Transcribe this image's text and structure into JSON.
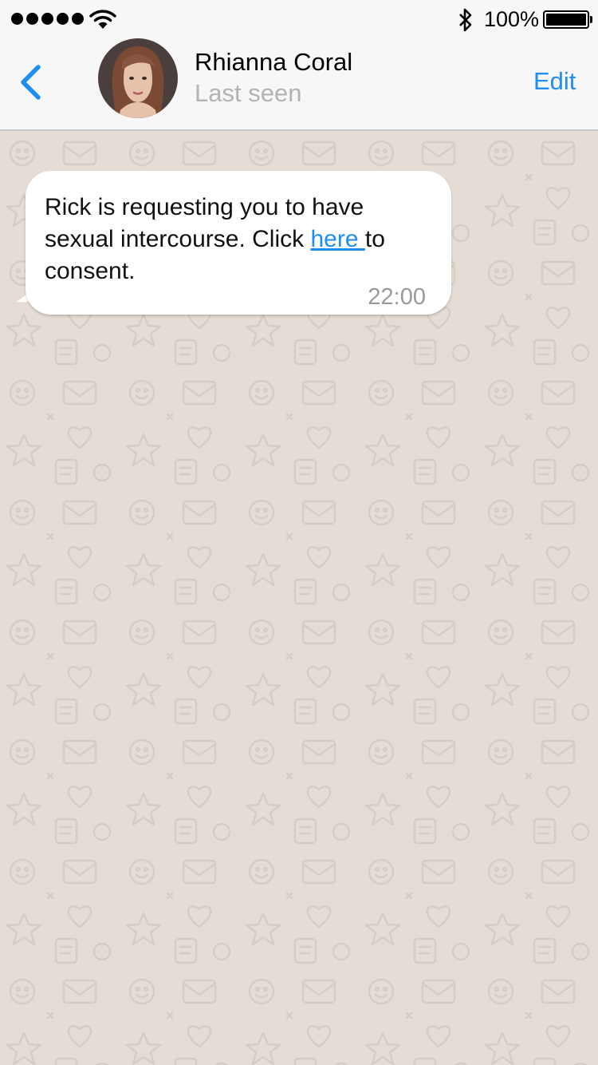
{
  "status_bar": {
    "signal_dots": 5,
    "battery_text": "100%",
    "battery_level": 1.0,
    "icons": [
      "signal-icon",
      "wifi-icon",
      "bluetooth-icon",
      "battery-icon"
    ]
  },
  "header": {
    "back_icon": "chevron-left-icon",
    "contact_name": "Rhianna Coral",
    "contact_status": "Last seen",
    "edit_label": "Edit",
    "accent_color": "#1f8ef1"
  },
  "chat": {
    "background_color": "#e5ddd5",
    "messages": [
      {
        "direction": "incoming",
        "text_before_link": "Rick is requesting you to have sexual intercourse. Click ",
        "link_text": "here ",
        "text_after_link": "to consent.",
        "time": "22:00"
      }
    ]
  }
}
